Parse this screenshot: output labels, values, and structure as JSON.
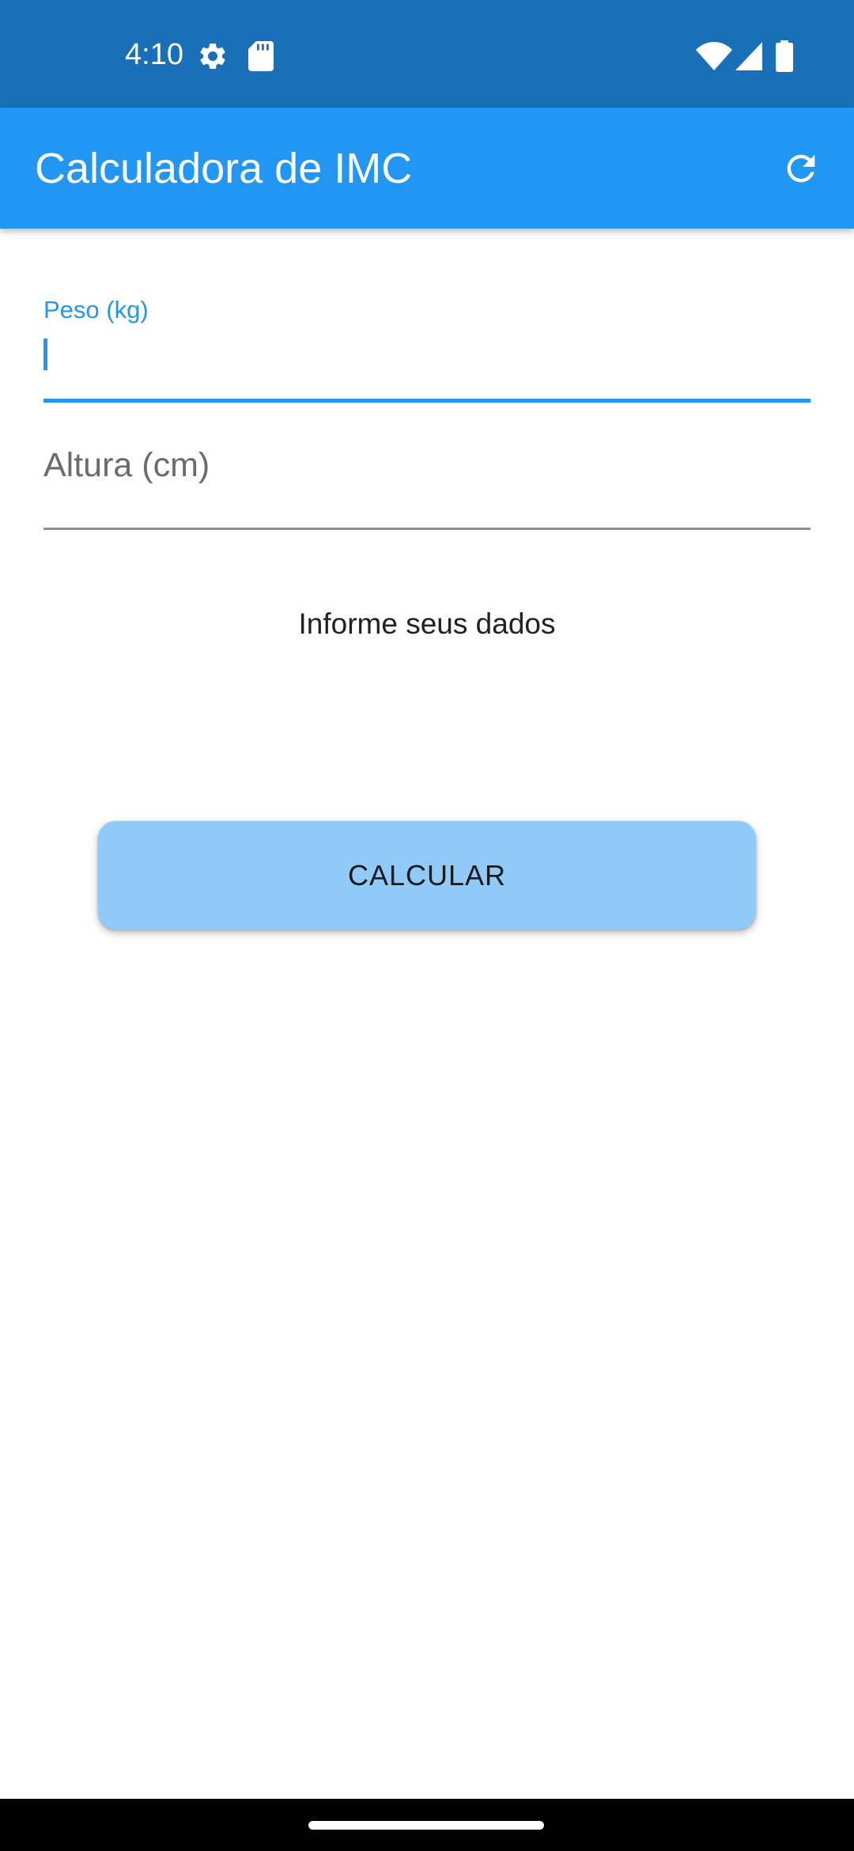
{
  "status_bar": {
    "time": "4:10",
    "icons": [
      "settings-icon",
      "sd-card-icon",
      "wifi-icon",
      "cell-signal-icon",
      "battery-icon"
    ]
  },
  "app_bar": {
    "title": "Calculadora de IMC",
    "action_icon": "refresh-icon"
  },
  "form": {
    "peso": {
      "label": "Peso (kg)",
      "value": "",
      "focused": true
    },
    "altura": {
      "label": "Altura (cm)",
      "value": "",
      "focused": false
    }
  },
  "info_text": "Informe seus dados",
  "calculate_button": {
    "label": "CALCULAR"
  },
  "colors": {
    "status_bar": "#1a70b8",
    "app_bar": "#2196f3",
    "accent": "#2196f3",
    "button": "#90caf9",
    "nav_bar": "#000000"
  }
}
